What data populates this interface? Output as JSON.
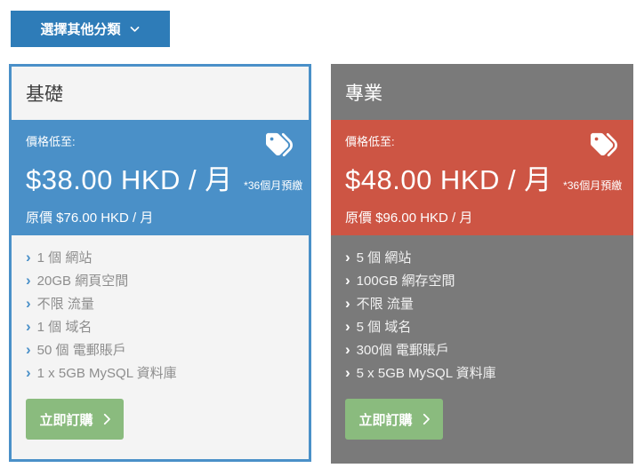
{
  "category_button": {
    "label": "選擇其他分類"
  },
  "icons": {
    "bullet": "›"
  },
  "colors": {
    "button_blue": "#2e7cb8",
    "accent_blue": "#4a90c8",
    "accent_red": "#cd5544",
    "card_gray": "#7a7a7a",
    "card_light_bg": "#f4f4f4",
    "order_green": "#8abb7e"
  },
  "plans": [
    {
      "name": "基礎",
      "price": {
        "prefix_label": "價格低至:",
        "amount": "$38.00 HKD / 月",
        "term_note": "*36個月預繳",
        "original": "原價 $76.00 HKD / 月"
      },
      "features": [
        "1 個 網站",
        "20GB 網頁空間",
        "不限 流量",
        "1 個 域名",
        "50 個 電郵賬戶",
        "1 x 5GB MySQL 資料庫"
      ],
      "order_label": "立即訂購"
    },
    {
      "name": "專業",
      "price": {
        "prefix_label": "價格低至:",
        "amount": "$48.00 HKD / 月",
        "term_note": "*36個月預繳",
        "original": "原價 $96.00 HKD / 月"
      },
      "features": [
        "5 個 網站",
        "100GB 網存空間",
        "不限 流量",
        "5 個 域名",
        "300個 電郵賬戶",
        "5 x 5GB MySQL 資料庫"
      ],
      "order_label": "立即訂購"
    }
  ]
}
